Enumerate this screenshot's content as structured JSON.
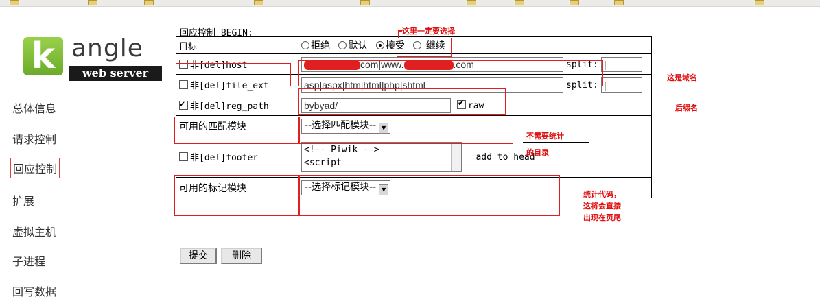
{
  "logo": {
    "mark": "k",
    "brand": "angle",
    "sub": "web server"
  },
  "sidebar": {
    "items": [
      {
        "label": "总体信息",
        "active": false
      },
      {
        "label": "请求控制",
        "active": false
      },
      {
        "label": "回应控制",
        "active": true
      },
      {
        "label": "扩展",
        "active": false
      },
      {
        "label": "虚拟主机",
        "active": false
      },
      {
        "label": "子进程",
        "active": false
      },
      {
        "label": "回写数据",
        "active": false
      }
    ]
  },
  "section_title": "回应控制 BEGIN:",
  "table": {
    "target_label": "目标",
    "target_options": [
      "拒绝",
      "默认",
      "接受",
      "继续"
    ],
    "target_selected": "接受",
    "host": {
      "label": "非[del]host",
      "checked": false,
      "value_mid": "com|www.",
      "value_tail": ".com",
      "split_label": "split:",
      "split_value": "|"
    },
    "file_ext": {
      "label": "非[del]file_ext",
      "checked": false,
      "value": "asp|aspx|htm|html|php|shtml",
      "split_label": "split:",
      "split_value": "|"
    },
    "reg_path": {
      "label": "非[del]reg_path",
      "checked": true,
      "value": "bybyad/",
      "raw_label": "raw",
      "raw_checked": true
    },
    "match_module": {
      "label": "可用的匹配模块",
      "select": "--选择匹配模块--"
    },
    "footer": {
      "label": "非[del]footer",
      "checked": false,
      "line1": "<!-- Piwik -->",
      "line2": "<script",
      "add_to_head": "add to head"
    },
    "mark_module": {
      "label": "可用的标记模块",
      "select": "--选择标记模块--"
    }
  },
  "buttons": {
    "submit": "提交",
    "delete": "删除"
  },
  "annotations": {
    "must_choose": "这里一定要选择",
    "domain": "这是域名",
    "suffix": "后缀名",
    "no_stats_1": "不需要统计",
    "no_stats_2": "的目录",
    "code_1": "统计代码，",
    "code_2": "这将会直接",
    "code_3": "出现在页尾"
  },
  "colors": {
    "annotation": "#e02020",
    "logo_green": "#7ab93a"
  }
}
